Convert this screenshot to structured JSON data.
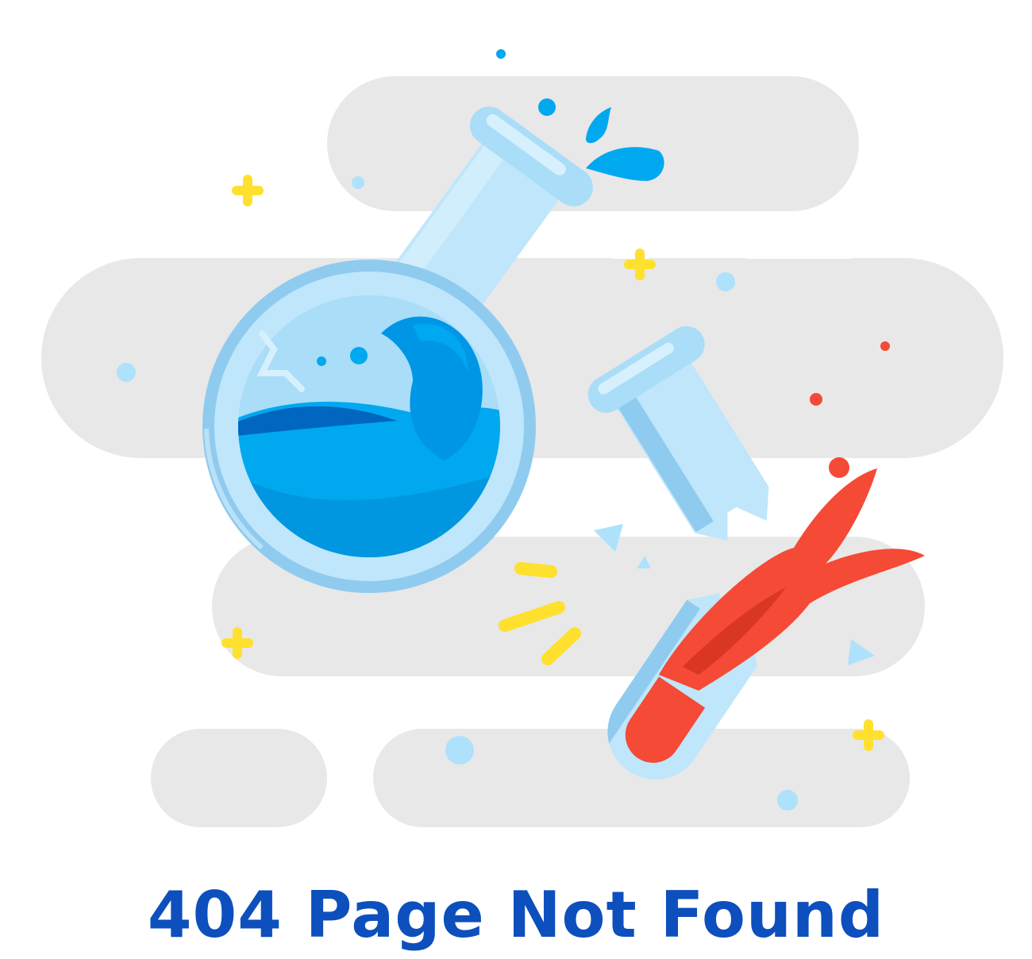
{
  "page": {
    "title": "404 Page Not Found"
  },
  "illustration": {
    "subject": "broken laboratory glassware: round-bottom flask and snapped test tube",
    "icons": [
      "flask-icon",
      "test-tube-icon",
      "sparkle-icon",
      "droplet-icon"
    ]
  },
  "colors": {
    "title": "#0d4fbd",
    "cloud": "#e8e8e8",
    "glass": "#bfe6fb",
    "glass_dark": "#8fcbee",
    "water": "#00a8f0",
    "water_dark": "#0078d0",
    "red_liquid": "#f44a36",
    "sparkle": "#ffe02e"
  }
}
